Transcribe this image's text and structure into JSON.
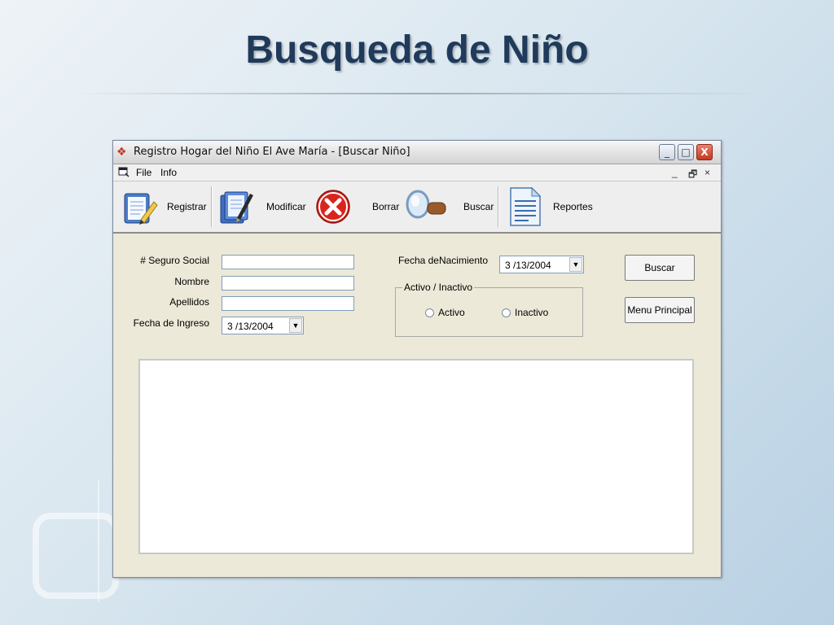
{
  "slide": {
    "title": "Busqueda de Niño"
  },
  "window": {
    "title": "Registro Hogar del Niño El Ave María - [Buscar Niño]",
    "controls": {
      "minimize": "_",
      "maximize": "□",
      "close": "X"
    }
  },
  "menu": {
    "items": [
      {
        "label": "File"
      },
      {
        "label": "Info"
      }
    ],
    "mdi": {
      "minimize": "_",
      "restore": "🗗",
      "close": "×"
    }
  },
  "toolbar": {
    "registrar": "Registrar",
    "modificar": "Modificar",
    "borrar": "Borrar",
    "buscar": "Buscar",
    "reportes": "Reportes"
  },
  "form": {
    "seguro_social": {
      "label": "# Seguro Social",
      "value": ""
    },
    "nombre": {
      "label": "Nombre",
      "value": ""
    },
    "apellidos": {
      "label": "Apellidos",
      "value": ""
    },
    "fecha_ingreso": {
      "label": "Fecha de Ingreso",
      "value": "3 /13/2004"
    },
    "fecha_nacimiento": {
      "label": "Fecha deNacimiento",
      "value": "3 /13/2004"
    },
    "estado": {
      "legend": "Activo / Inactivo",
      "options": [
        {
          "label": "Activo"
        },
        {
          "label": "Inactivo"
        }
      ]
    },
    "buttons": {
      "buscar": "Buscar",
      "menu_principal": "Menu Principal"
    }
  },
  "colors": {
    "title": "#1f3a5a",
    "close_button": "#c4381e",
    "window_bg": "#ece9d8"
  }
}
